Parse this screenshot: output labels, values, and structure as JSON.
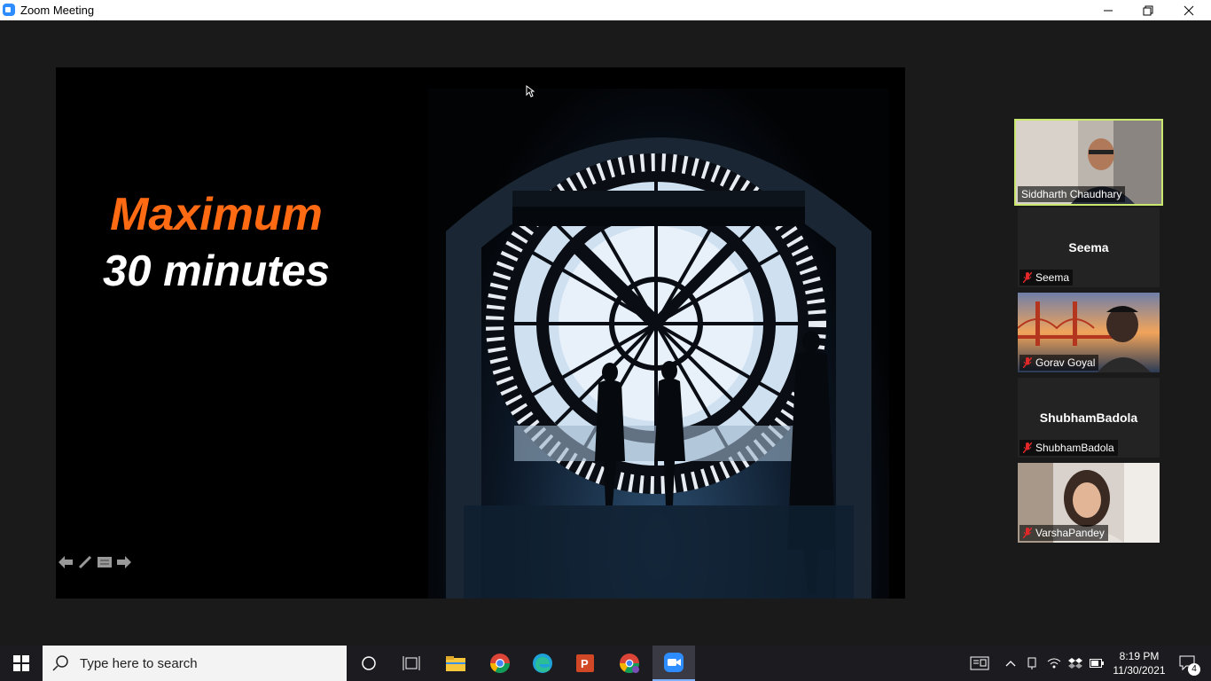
{
  "window": {
    "title": "Zoom Meeting"
  },
  "slide": {
    "title": "Maximum",
    "subtitle": "30 minutes"
  },
  "participants": [
    {
      "name": "Siddharth Chaudhary",
      "video": true,
      "active_speaker": true
    },
    {
      "name": "Seema",
      "display_name": "Seema",
      "video": false,
      "muted": true
    },
    {
      "name": "Gorav Goyal",
      "video": true,
      "muted": true
    },
    {
      "name": "ShubhamBadola",
      "display_name": "ShubhamBadola",
      "video": false,
      "muted": true
    },
    {
      "name": "VarshaPandey",
      "video": true,
      "muted": true
    }
  ],
  "taskbar": {
    "search_placeholder": "Type here to search",
    "time": "8:19 PM",
    "date": "11/30/2021",
    "notification_count": "4"
  },
  "colors": {
    "accent_orange": "#ff6a13",
    "active_speaker_border": "#c9e86d",
    "zoom_blue": "#2d8cff",
    "muted_red": "#e02828"
  }
}
